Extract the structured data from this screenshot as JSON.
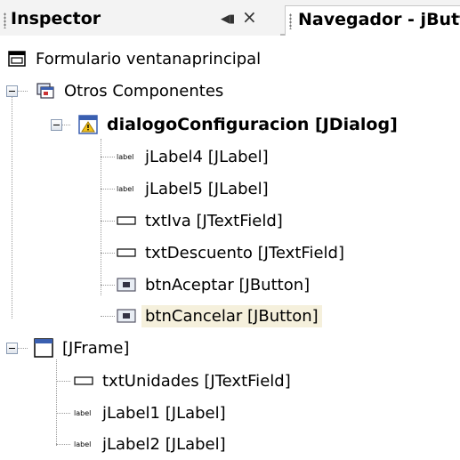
{
  "tabs": {
    "active_label": "Inspector",
    "minimize_glyph": "◀▮",
    "close_glyph": "×",
    "inactive_label": "Navegador - jButt"
  },
  "tree": {
    "root": "Formulario ventanaprincipal",
    "otros": "Otros Componentes",
    "dialog": "dialogoConfiguracion [JDialog]",
    "dialog_children": [
      "jLabel4 [JLabel]",
      "jLabel5 [JLabel]",
      "txtIva [JTextField]",
      "txtDescuento [JTextField]",
      "btnAceptar [JButton]",
      "btnCancelar [JButton]"
    ],
    "frame": "[JFrame]",
    "frame_children": [
      "txtUnidades [JTextField]",
      "jLabel1 [JLabel]",
      "jLabel2 [JLabel]"
    ]
  },
  "icons": {
    "root": "form-icon",
    "otros": "components-icon",
    "dialog": "dialog-icon",
    "label": "label-icon",
    "textfield": "textfield-icon",
    "button": "button-icon",
    "frame": "frame-icon"
  }
}
